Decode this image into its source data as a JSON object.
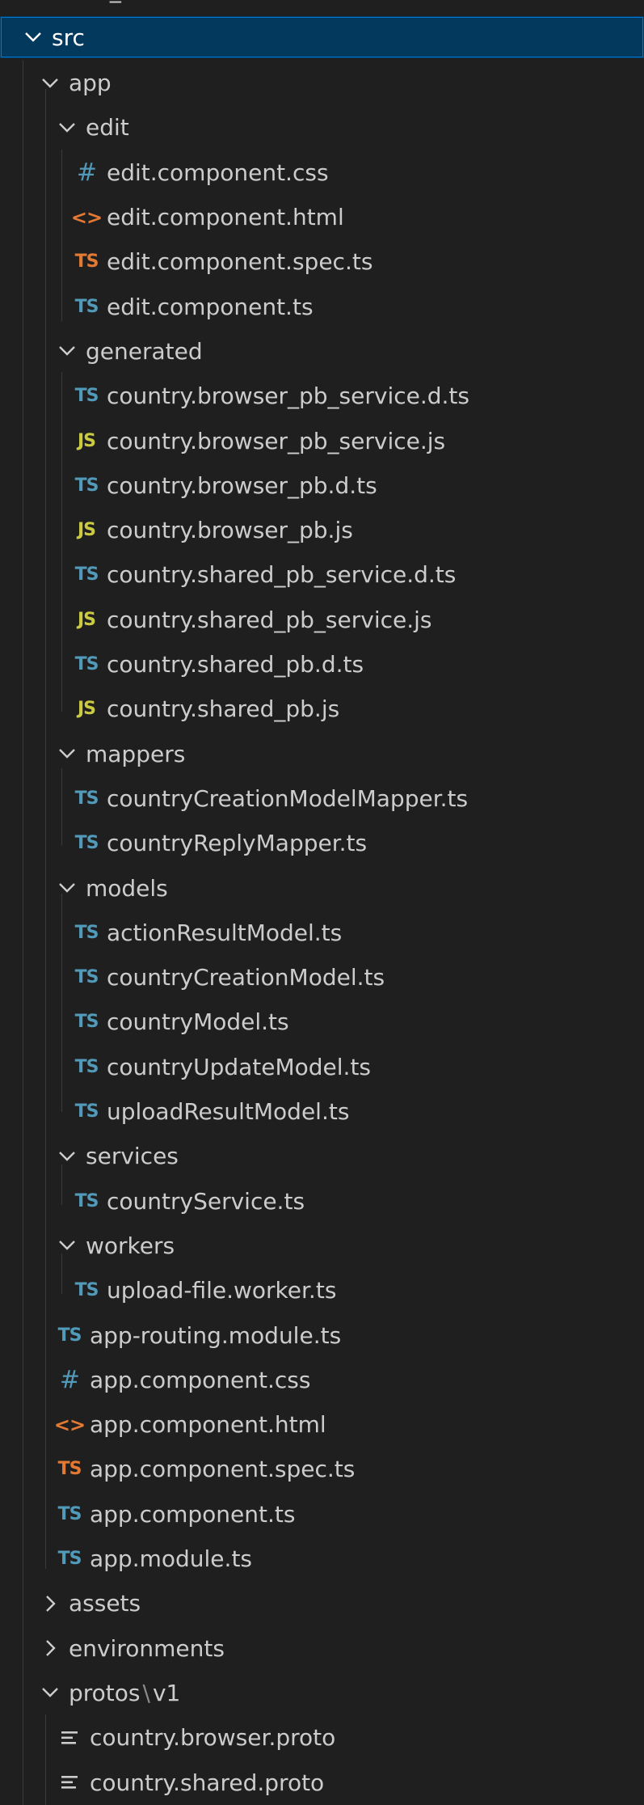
{
  "explorer": {
    "top_partial_row": {
      "label": "node_modules"
    },
    "root": {
      "label": "src",
      "expanded": true,
      "selected": true
    },
    "rows": [
      {
        "label": "app",
        "kind": "folder",
        "expanded": true,
        "icon": "chevron-down-icon"
      },
      {
        "label": "edit",
        "kind": "folder",
        "expanded": true,
        "icon": "chevron-down-icon"
      },
      {
        "label": "edit.component.css",
        "kind": "file",
        "icon": "css-file-icon",
        "glyph": "#"
      },
      {
        "label": "edit.component.html",
        "kind": "file",
        "icon": "html-file-icon",
        "glyph": "<>"
      },
      {
        "label": "edit.component.spec.ts",
        "kind": "file",
        "icon": "typescript-spec-file-icon",
        "glyph": "TS"
      },
      {
        "label": "edit.component.ts",
        "kind": "file",
        "icon": "typescript-file-icon",
        "glyph": "TS"
      },
      {
        "label": "generated",
        "kind": "folder",
        "expanded": true,
        "icon": "chevron-down-icon"
      },
      {
        "label": "country.browser_pb_service.d.ts",
        "kind": "file",
        "icon": "typescript-file-icon",
        "glyph": "TS"
      },
      {
        "label": "country.browser_pb_service.js",
        "kind": "file",
        "icon": "javascript-file-icon",
        "glyph": "JS"
      },
      {
        "label": "country.browser_pb.d.ts",
        "kind": "file",
        "icon": "typescript-file-icon",
        "glyph": "TS"
      },
      {
        "label": "country.browser_pb.js",
        "kind": "file",
        "icon": "javascript-file-icon",
        "glyph": "JS"
      },
      {
        "label": "country.shared_pb_service.d.ts",
        "kind": "file",
        "icon": "typescript-file-icon",
        "glyph": "TS"
      },
      {
        "label": "country.shared_pb_service.js",
        "kind": "file",
        "icon": "javascript-file-icon",
        "glyph": "JS"
      },
      {
        "label": "country.shared_pb.d.ts",
        "kind": "file",
        "icon": "typescript-file-icon",
        "glyph": "TS"
      },
      {
        "label": "country.shared_pb.js",
        "kind": "file",
        "icon": "javascript-file-icon",
        "glyph": "JS"
      },
      {
        "label": "mappers",
        "kind": "folder",
        "expanded": true,
        "icon": "chevron-down-icon"
      },
      {
        "label": "countryCreationModelMapper.ts",
        "kind": "file",
        "icon": "typescript-file-icon",
        "glyph": "TS"
      },
      {
        "label": "countryReplyMapper.ts",
        "kind": "file",
        "icon": "typescript-file-icon",
        "glyph": "TS"
      },
      {
        "label": "models",
        "kind": "folder",
        "expanded": true,
        "icon": "chevron-down-icon"
      },
      {
        "label": "actionResultModel.ts",
        "kind": "file",
        "icon": "typescript-file-icon",
        "glyph": "TS"
      },
      {
        "label": "countryCreationModel.ts",
        "kind": "file",
        "icon": "typescript-file-icon",
        "glyph": "TS"
      },
      {
        "label": "countryModel.ts",
        "kind": "file",
        "icon": "typescript-file-icon",
        "glyph": "TS"
      },
      {
        "label": "countryUpdateModel.ts",
        "kind": "file",
        "icon": "typescript-file-icon",
        "glyph": "TS"
      },
      {
        "label": "uploadResultModel.ts",
        "kind": "file",
        "icon": "typescript-file-icon",
        "glyph": "TS"
      },
      {
        "label": "services",
        "kind": "folder",
        "expanded": true,
        "icon": "chevron-down-icon"
      },
      {
        "label": "countryService.ts",
        "kind": "file",
        "icon": "typescript-file-icon",
        "glyph": "TS"
      },
      {
        "label": "workers",
        "kind": "folder",
        "expanded": true,
        "icon": "chevron-down-icon"
      },
      {
        "label": "upload-file.worker.ts",
        "kind": "file",
        "icon": "typescript-file-icon",
        "glyph": "TS"
      },
      {
        "label": "app-routing.module.ts",
        "kind": "file",
        "icon": "typescript-file-icon",
        "glyph": "TS"
      },
      {
        "label": "app.component.css",
        "kind": "file",
        "icon": "css-file-icon",
        "glyph": "#"
      },
      {
        "label": "app.component.html",
        "kind": "file",
        "icon": "html-file-icon",
        "glyph": "<>"
      },
      {
        "label": "app.component.spec.ts",
        "kind": "file",
        "icon": "typescript-spec-file-icon",
        "glyph": "TS"
      },
      {
        "label": "app.component.ts",
        "kind": "file",
        "icon": "typescript-file-icon",
        "glyph": "TS"
      },
      {
        "label": "app.module.ts",
        "kind": "file",
        "icon": "typescript-file-icon",
        "glyph": "TS"
      },
      {
        "label": "assets",
        "kind": "folder",
        "expanded": false,
        "icon": "chevron-right-icon"
      },
      {
        "label": "environments",
        "kind": "folder",
        "expanded": false,
        "icon": "chevron-right-icon"
      },
      {
        "label": "protos",
        "label_suffix": "v1",
        "separator": "\\",
        "kind": "folder",
        "expanded": true,
        "icon": "chevron-down-icon"
      },
      {
        "label": "country.browser.proto",
        "kind": "file",
        "icon": "proto-file-icon",
        "glyph": "≡"
      },
      {
        "label": "country.shared.proto",
        "kind": "file",
        "icon": "proto-file-icon",
        "glyph": "≡"
      }
    ]
  },
  "colors": {
    "background": "#1f1f1f",
    "selection": "#04395e",
    "selection_border": "#0078d4",
    "text": "#cccccc",
    "typescript": "#519aba",
    "typescript_spec": "#e37933",
    "javascript": "#cbcb41",
    "css": "#519aba",
    "html": "#e37933",
    "indent_guide": "#3a3a3a"
  }
}
